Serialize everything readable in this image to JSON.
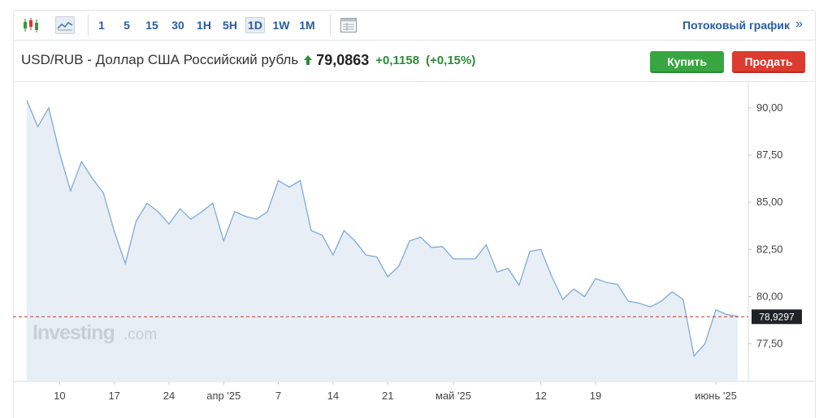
{
  "toolbar": {
    "intervals": [
      "1",
      "5",
      "15",
      "30",
      "1H",
      "5H",
      "1D",
      "1W",
      "1M"
    ],
    "active_interval": "1D",
    "stream_label": "Потоковый график",
    "stream_chevron": "»"
  },
  "header": {
    "title": "USD/RUB - Доллар США Российский рубль",
    "price": "79,0863",
    "change": "+0,1158",
    "change_pct": "(+0,15%)"
  },
  "buttons": {
    "buy": "Купить",
    "sell": "Продать"
  },
  "colors": {
    "line": "#7eaad6",
    "fill": "#e8eef5",
    "up": "#2e8b3b",
    "buy": "#37a640",
    "sell": "#dc3b2f",
    "ref_line": "#c0392b"
  },
  "watermark": {
    "brand": "Investing",
    "suffix": ".com"
  },
  "chart_data": {
    "type": "area",
    "x_tick_labels": [
      "10",
      "17",
      "24",
      "апр '25",
      "7",
      "14",
      "21",
      "май '25",
      "12",
      "19",
      "июнь '25"
    ],
    "x_tick_index": [
      3,
      8,
      13,
      18,
      23,
      28,
      33,
      39,
      47,
      52,
      63
    ],
    "y_ticks": [
      77.5,
      80,
      82.5,
      85,
      87.5,
      90
    ],
    "y_tick_labels": [
      "77,50",
      "80,00",
      "82,50",
      "85,00",
      "87,50",
      "90,00"
    ],
    "ylim": [
      75.5,
      90.9
    ],
    "y_axis_position": "right",
    "reference_value": 78.9297,
    "reference_label": "78,9297",
    "values": [
      90.4,
      89.0,
      90.0,
      87.6,
      85.6,
      87.15,
      86.25,
      85.5,
      83.45,
      81.75,
      84.0,
      84.95,
      84.5,
      83.85,
      84.65,
      84.1,
      84.5,
      84.95,
      82.95,
      84.5,
      84.25,
      84.1,
      84.5,
      86.15,
      85.8,
      86.15,
      83.5,
      83.25,
      82.2,
      83.5,
      82.95,
      82.2,
      82.1,
      81.05,
      81.6,
      82.95,
      83.15,
      82.6,
      82.65,
      82.0,
      82.0,
      82.0,
      82.75,
      81.3,
      81.5,
      80.6,
      82.4,
      82.5,
      81.05,
      79.85,
      80.4,
      80.0,
      80.95,
      80.75,
      80.65,
      79.75,
      79.65,
      79.45,
      79.75,
      80.25,
      79.85,
      76.85,
      77.5,
      79.3,
      79.05,
      78.95
    ]
  }
}
